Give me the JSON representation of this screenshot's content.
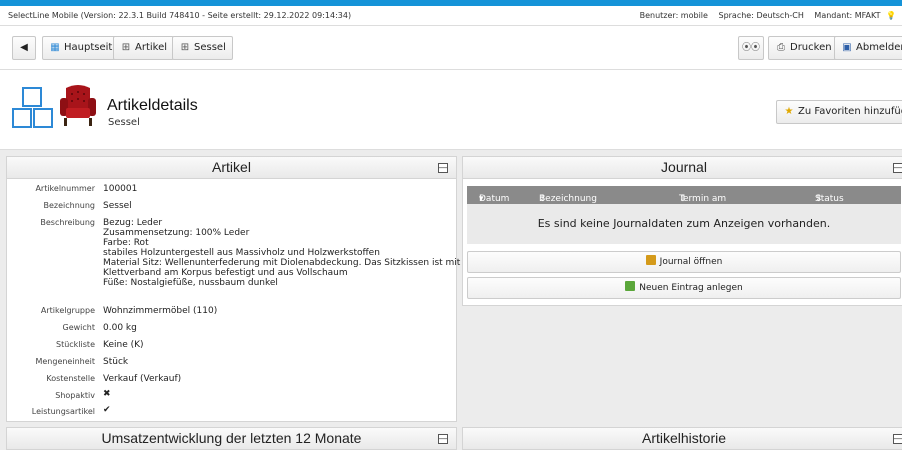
{
  "infobar": {
    "version_text": "SelectLine Mobile (Version: 22.3.1 Build 748410 - Seite erstellt: 29.12.2022 09:14:34)",
    "user": "Benutzer: mobile",
    "language": "Sprache: Deutsch-CH",
    "mandant": "Mandant: MFAKT"
  },
  "nav": {
    "back_icon": "triangle-left-icon",
    "breadcrumbs": [
      {
        "label": "Hauptseite",
        "icon": "grid-icon"
      },
      {
        "label": "Artikel",
        "icon": "hierarchy-icon"
      },
      {
        "label": "Sessel",
        "icon": "hierarchy-icon"
      }
    ],
    "glasses_icon": "glasses-icon",
    "print_label": "Drucken",
    "logout_label": "Abmelden"
  },
  "header": {
    "title": "Artikeldetails",
    "subtitle": "Sessel",
    "favorite_label": "Zu Favoriten hinzufügen"
  },
  "artikel_panel": {
    "title": "Artikel",
    "fields": {
      "artikelnummer": {
        "label": "Artikelnummer",
        "value": "100001"
      },
      "bezeichnung": {
        "label": "Bezeichnung",
        "value": "Sessel"
      },
      "beschreibung": {
        "label": "Beschreibung",
        "lines": [
          "Bezug: Leder",
          "Zusammensetzung: 100% Leder",
          "Farbe: Rot",
          "stabiles Holzuntergestell aus Massivholz und Holzwerkstoffen",
          "Material Sitz: Wellenunterfederung mit Diolenabdeckung. Das Sitzkissen ist mit",
          "Klettverband am Korpus befestigt und aus Vollschaum",
          "Füße: Nostalgiefüße, nussbaum dunkel"
        ]
      },
      "artikelgruppe": {
        "label": "Artikelgruppe",
        "value": "Wohnzimmermöbel (110)"
      },
      "gewicht": {
        "label": "Gewicht",
        "value": "0.00 kg"
      },
      "stueckliste": {
        "label": "Stückliste",
        "value": "Keine (K)"
      },
      "mengeneinheit": {
        "label": "Mengeneinheit",
        "value": "Stück"
      },
      "kostenstelle": {
        "label": "Kostenstelle",
        "value": "Verkauf (Verkauf)"
      },
      "shopaktiv": {
        "label": "Shopaktiv",
        "icon": "x-icon"
      },
      "leistungsartikel": {
        "label": "Leistungsartikel",
        "icon": "check-icon"
      }
    }
  },
  "journal_panel": {
    "title": "Journal",
    "columns": [
      "Datum",
      "Bezeichnung",
      "Termin am",
      "Status"
    ],
    "empty_text": "Es sind keine Journaldaten zum Anzeigen vorhanden.",
    "open_label": "Journal öffnen",
    "new_label": "Neuen Eintrag anlegen"
  },
  "umsatz_panel": {
    "title": "Umsatzentwicklung der letzten 12 Monate"
  },
  "historie_panel": {
    "title": "Artikelhistorie"
  },
  "colors": {
    "accent": "#1593d8",
    "table_header": "#8a8a8a"
  }
}
